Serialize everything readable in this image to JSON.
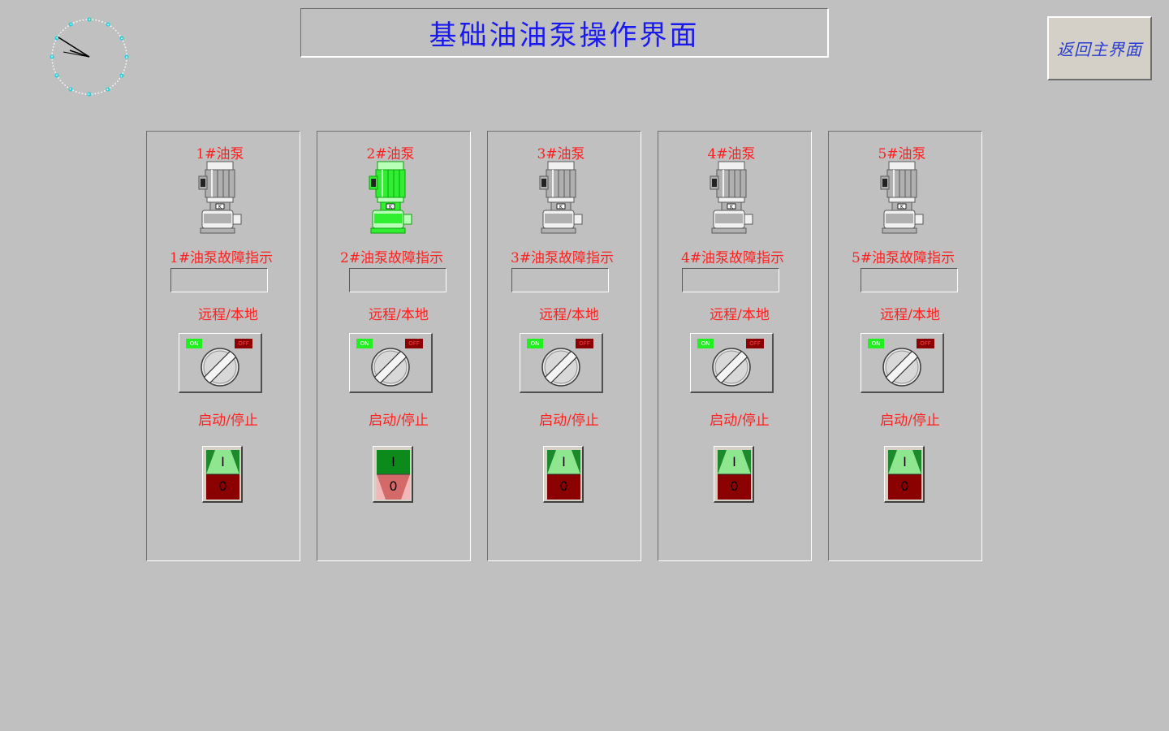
{
  "title": "基础油油泵操作界面",
  "return_button": "返回主界面",
  "colors": {
    "background": "#c0c0c0",
    "title_text": "#1a1af0",
    "label_text": "#ff2020",
    "pump_running": "#22ee22",
    "pump_stopped": "#a8a8a8"
  },
  "pumps": [
    {
      "label": "1#油泵",
      "fault_label": "1#油泵故障指示",
      "mode_label": "远程/本地",
      "run_label": "启动/停止",
      "selector_on": "ON",
      "selector_off": "OFF",
      "rocker_on": "I",
      "rocker_off": "0",
      "running": false
    },
    {
      "label": "2#油泵",
      "fault_label": "2#油泵故障指示",
      "mode_label": "远程/本地",
      "run_label": "启动/停止",
      "selector_on": "ON",
      "selector_off": "OFF",
      "rocker_on": "I",
      "rocker_off": "0",
      "running": true
    },
    {
      "label": "3#油泵",
      "fault_label": "3#油泵故障指示",
      "mode_label": "远程/本地",
      "run_label": "启动/停止",
      "selector_on": "ON",
      "selector_off": "OFF",
      "rocker_on": "I",
      "rocker_off": "0",
      "running": false
    },
    {
      "label": "4#油泵",
      "fault_label": "4#油泵故障指示",
      "mode_label": "远程/本地",
      "run_label": "启动/停止",
      "selector_on": "ON",
      "selector_off": "OFF",
      "rocker_on": "I",
      "rocker_off": "0",
      "running": false
    },
    {
      "label": "5#油泵",
      "fault_label": "5#油泵故障指示",
      "mode_label": "远程/本地",
      "run_label": "启动/停止",
      "selector_on": "ON",
      "selector_off": "OFF",
      "rocker_on": "I",
      "rocker_off": "0",
      "running": false
    }
  ]
}
